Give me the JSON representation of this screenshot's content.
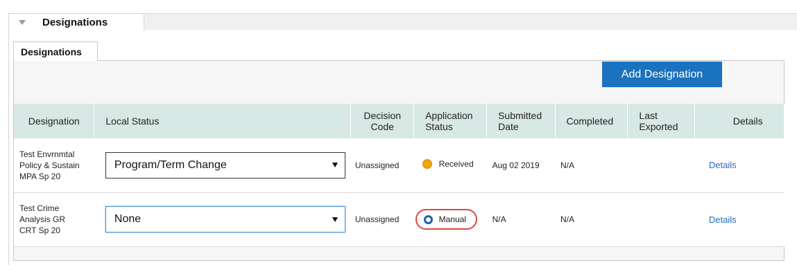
{
  "section": {
    "title": "Designations"
  },
  "tab": {
    "label": "Designations"
  },
  "toolbar": {
    "add_label": "Add Designation"
  },
  "colors": {
    "accent": "#1b72bf",
    "header_bg": "#d8e8e4",
    "received": "#f0a410",
    "manual": "#1f5fa8",
    "highlight": "#e0463f"
  },
  "table": {
    "headers": [
      "Designation",
      "Local Status",
      "Decision Code",
      "Application Status",
      "Submitted Date",
      "Completed",
      "Last Exported",
      "Details"
    ],
    "rows": [
      {
        "designation": [
          "Test Envrnmtal",
          "Policy & Sustain",
          "MPA Sp 20"
        ],
        "local_status": "Program/Term Change",
        "decision_code": "Unassigned",
        "application_status": "Received",
        "submitted_date": "Aug 02 2019",
        "completed": "N/A",
        "last_exported": "",
        "details": "Details"
      },
      {
        "designation": [
          "Test Crime",
          "Analysis GR",
          "CRT Sp 20"
        ],
        "local_status": "None",
        "decision_code": "Unassigned",
        "application_status": "Manual",
        "submitted_date": "N/A",
        "completed": "N/A",
        "last_exported": "",
        "details": "Details"
      }
    ]
  }
}
